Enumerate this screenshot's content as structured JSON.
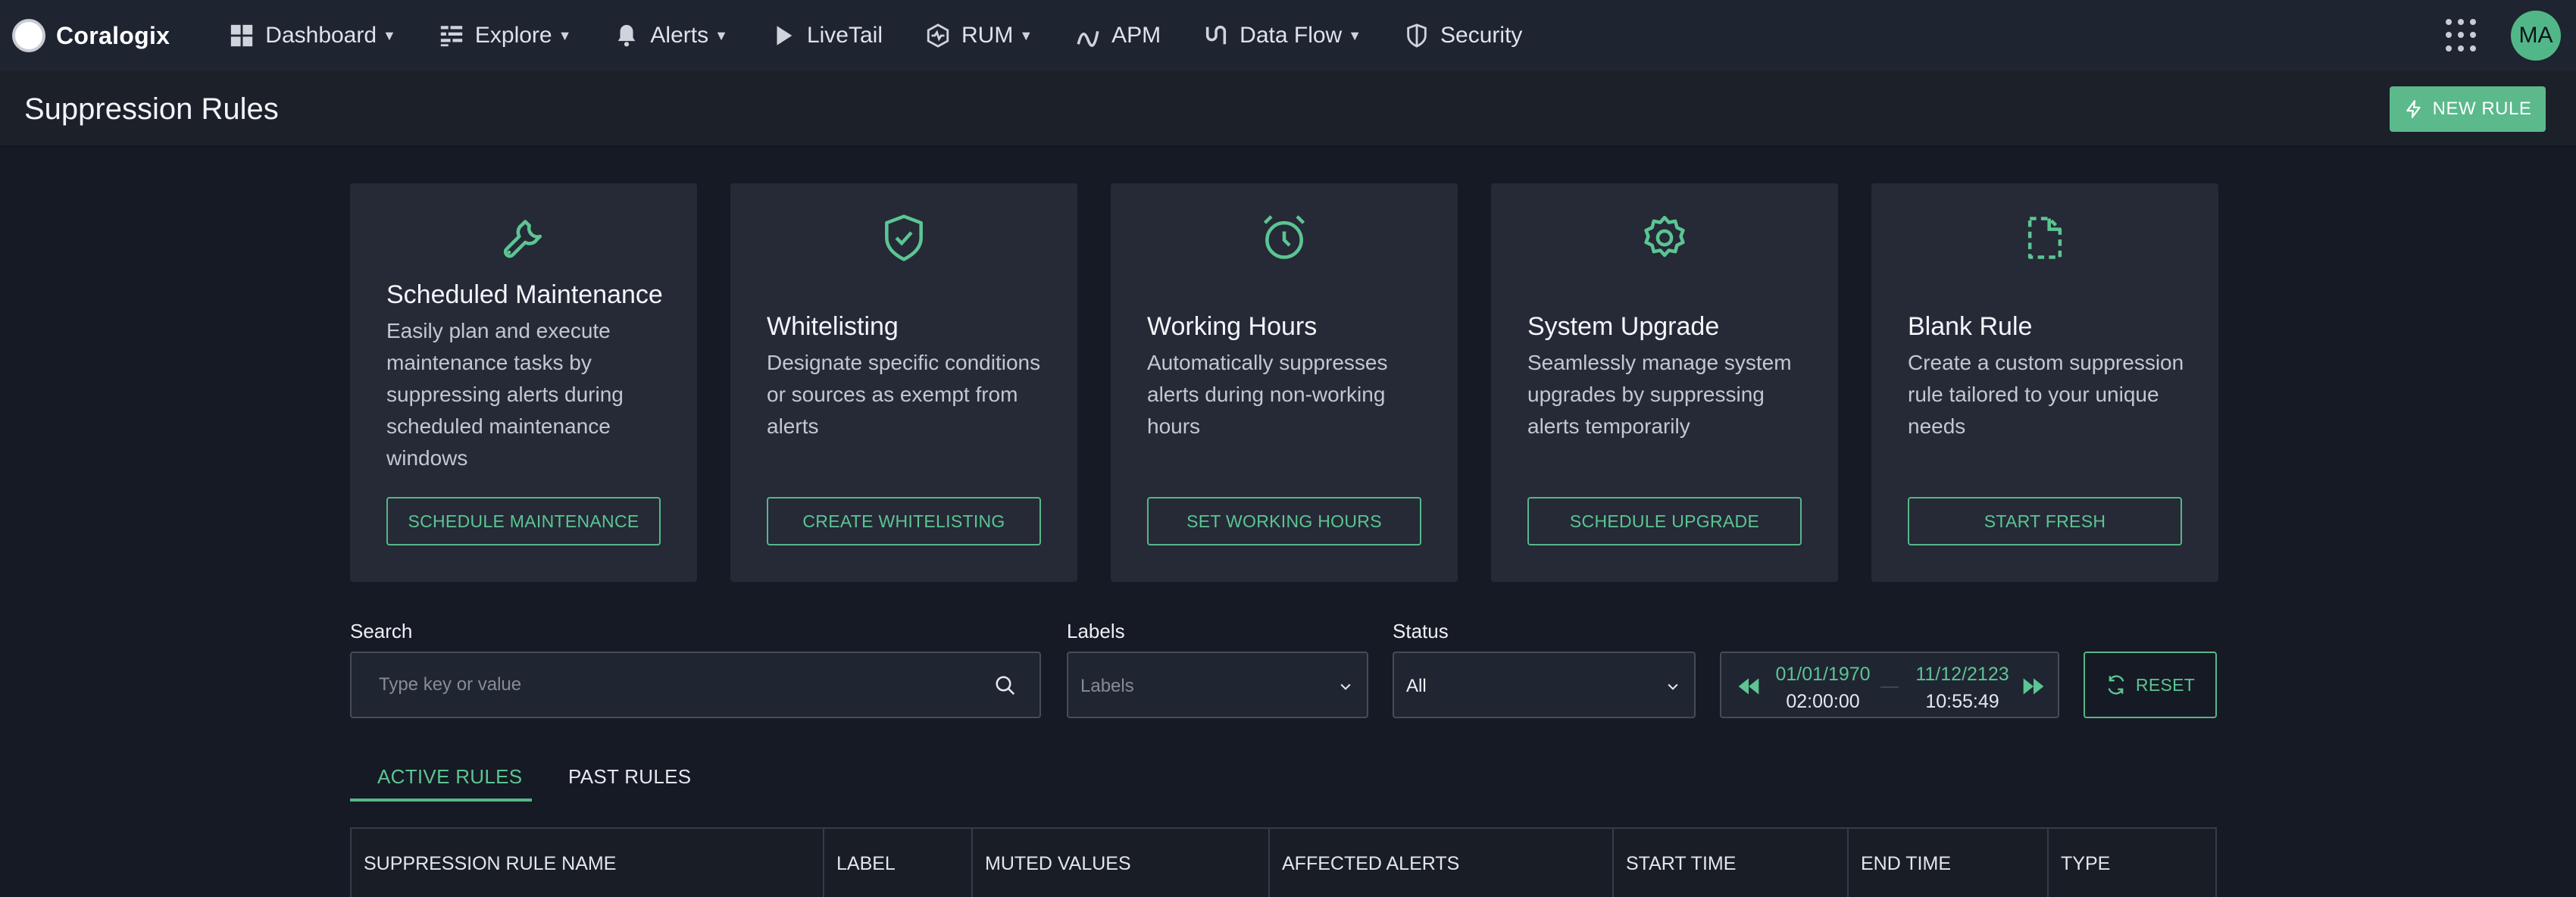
{
  "app": {
    "logo_text": "Coralogix"
  },
  "nav": {
    "items": [
      {
        "label": "Dashboard",
        "icon": "dashboard-icon",
        "dropdown": true
      },
      {
        "label": "Explore",
        "icon": "explore-icon",
        "dropdown": true
      },
      {
        "label": "Alerts",
        "icon": "bell-icon",
        "dropdown": true
      },
      {
        "label": "LiveTail",
        "icon": "play-icon",
        "dropdown": false
      },
      {
        "label": "RUM",
        "icon": "rum-icon",
        "dropdown": true
      },
      {
        "label": "APM",
        "icon": "apm-icon",
        "dropdown": false
      },
      {
        "label": "Data Flow",
        "icon": "data-flow-icon",
        "dropdown": true
      },
      {
        "label": "Security",
        "icon": "shield-icon",
        "dropdown": false
      }
    ],
    "avatar_initials": "MA"
  },
  "header": {
    "title": "Suppression Rules",
    "new_rule_label": "NEW RULE"
  },
  "cards": [
    {
      "title": "Scheduled Maintenance",
      "icon": "wrench-icon",
      "description": "Easily plan and execute maintenance tasks by suppressing alerts during scheduled maintenance windows",
      "button": "SCHEDULE MAINTENANCE"
    },
    {
      "title": "Whitelisting",
      "icon": "shield-check-icon",
      "description": "Designate specific conditions or sources as exempt from alerts",
      "button": "CREATE WHITELISTING"
    },
    {
      "title": "Working Hours",
      "icon": "alarm-clock-icon",
      "description": "Automatically suppresses alerts during non-working hours",
      "button": "SET WORKING HOURS"
    },
    {
      "title": "System Upgrade",
      "icon": "gear-icon",
      "description": "Seamlessly manage system upgrades by suppressing alerts temporarily",
      "button": "SCHEDULE UPGRADE"
    },
    {
      "title": "Blank Rule",
      "icon": "blank-file-icon",
      "description": "Create a custom suppression rule tailored to your unique needs",
      "button": "START FRESH"
    }
  ],
  "filters": {
    "search_label": "Search",
    "search_placeholder": "Type key or value",
    "labels_label": "Labels",
    "labels_placeholder": "Labels",
    "status_label": "Status",
    "status_value": "All",
    "date_start": "01/01/1970",
    "time_start": "02:00:00",
    "date_end": "11/12/2123",
    "time_end": "10:55:49",
    "reset_label": "RESET"
  },
  "tabs": [
    {
      "label": "ACTIVE RULES",
      "active": true
    },
    {
      "label": "PAST RULES",
      "active": false
    }
  ],
  "table": {
    "columns": [
      "SUPPRESSION RULE NAME",
      "LABEL",
      "MUTED VALUES",
      "AFFECTED ALERTS",
      "START TIME",
      "END TIME",
      "TYPE"
    ]
  },
  "colors": {
    "accent": "#5cc593",
    "background": "#161a24",
    "nav_bg": "#1e2430",
    "card_bg": "#252a36"
  }
}
